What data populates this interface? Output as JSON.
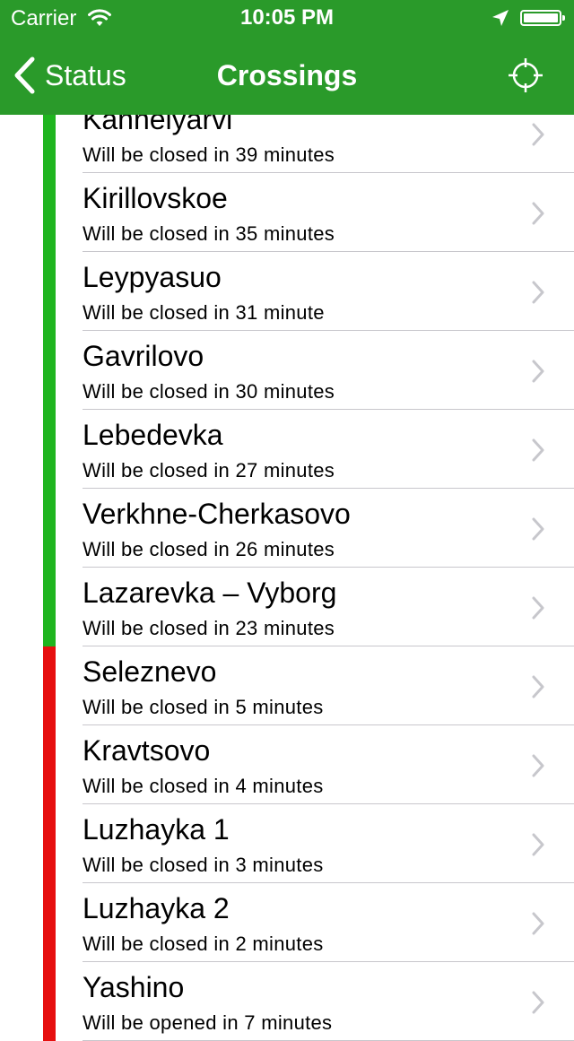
{
  "status_bar": {
    "carrier": "Carrier",
    "time": "10:05 PM",
    "icons": [
      "wifi-icon",
      "location-arrow-icon",
      "battery-icon"
    ]
  },
  "nav": {
    "back_label": "Status",
    "title": "Crossings",
    "right_icon": "crosshair-icon"
  },
  "colors": {
    "nav_bg": "#2a9a2a",
    "open": "#1fb51f",
    "closing_soon": "#e60f0f",
    "separator": "#c8c7cc"
  },
  "crossings": [
    {
      "name": "Kannelyarvi",
      "status": "Will be closed in 39 minutes",
      "color": "#1fb51f"
    },
    {
      "name": "Kirillovskoe",
      "status": "Will be closed in 35 minutes",
      "color": "#1fb51f"
    },
    {
      "name": "Leypyasuo",
      "status": "Will be closed in 31 minute",
      "color": "#1fb51f"
    },
    {
      "name": "Gavrilovo",
      "status": "Will be closed in 30 minutes",
      "color": "#1fb51f"
    },
    {
      "name": "Lebedevka",
      "status": "Will be closed in 27 minutes",
      "color": "#1fb51f"
    },
    {
      "name": "Verkhne-Cherkasovo",
      "status": "Will be closed in 26 minutes",
      "color": "#1fb51f"
    },
    {
      "name": "Lazarevka – Vyborg",
      "status": "Will be closed in 23 minutes",
      "color": "#1fb51f"
    },
    {
      "name": "Seleznevo",
      "status": "Will be closed in 5 minutes",
      "color": "#e60f0f"
    },
    {
      "name": "Kravtsovo",
      "status": "Will be closed in 4 minutes",
      "color": "#e60f0f"
    },
    {
      "name": "Luzhayka 1",
      "status": "Will be closed in 3 minutes",
      "color": "#e60f0f"
    },
    {
      "name": "Luzhayka 2",
      "status": "Will be closed in 2 minutes",
      "color": "#e60f0f"
    },
    {
      "name": "Yashino",
      "status": "Will be opened in 7 minutes",
      "color": "#e60f0f"
    }
  ]
}
